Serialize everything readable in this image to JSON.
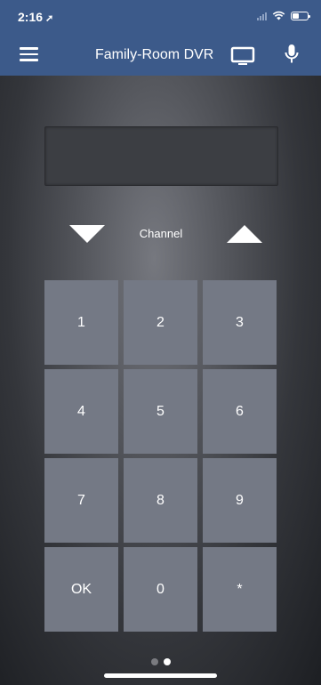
{
  "status_bar": {
    "time": "2:16",
    "location_arrow": "location-arrow-icon",
    "signal_icon": "cellular-signal-icon",
    "wifi_icon": "wifi-icon",
    "battery_icon": "battery-icon"
  },
  "header": {
    "menu_icon": "hamburger-menu-icon",
    "title": "Family-Room DVR",
    "tv_icon": "tv-icon",
    "mic_icon": "microphone-icon",
    "background": "#3c5a8a"
  },
  "remote": {
    "display_text": "",
    "channel_label": "Channel",
    "channel_down_icon": "triangle-down-icon",
    "channel_up_icon": "triangle-up-icon",
    "key_color": "#747985",
    "keys": [
      "1",
      "2",
      "3",
      "4",
      "5",
      "6",
      "7",
      "8",
      "9",
      "OK",
      "0",
      "*"
    ]
  },
  "pager": {
    "page_count": 2,
    "current_page": 2
  }
}
